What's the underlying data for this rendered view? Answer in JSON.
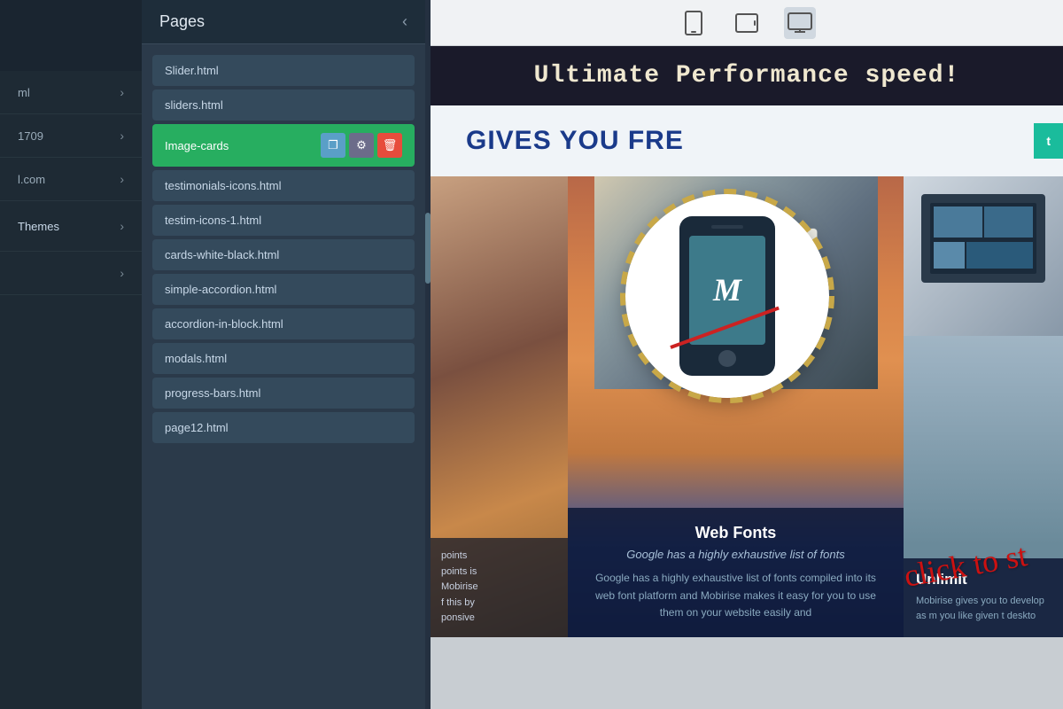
{
  "leftSidebar": {
    "items": [
      {
        "id": "item1",
        "label": "ml",
        "hasArrow": true
      },
      {
        "id": "item2",
        "label": "1709",
        "hasArrow": true
      },
      {
        "id": "item3",
        "label": "l.com",
        "hasArrow": true
      },
      {
        "id": "item4",
        "label": "& Themes",
        "hasArrow": true
      },
      {
        "id": "item5",
        "label": "",
        "hasArrow": true
      }
    ]
  },
  "pagesPanel": {
    "title": "Pages",
    "closeButton": "‹",
    "items": [
      {
        "id": "slider",
        "label": "Slider.html",
        "active": false
      },
      {
        "id": "sliders",
        "label": "sliders.html",
        "active": false
      },
      {
        "id": "image-cards",
        "label": "Image-cards",
        "active": true
      },
      {
        "id": "testimonials-icons",
        "label": "testimonials-icons.html",
        "active": false
      },
      {
        "id": "testim-icons-1",
        "label": "testim-icons-1.html",
        "active": false
      },
      {
        "id": "cards-white-black",
        "label": "cards-white-black.html",
        "active": false
      },
      {
        "id": "simple-accordion",
        "label": "simple-accordion.html",
        "active": false
      },
      {
        "id": "accordion-in-block",
        "label": "accordion-in-block.html",
        "active": false
      },
      {
        "id": "modals",
        "label": "modals.html",
        "active": false
      },
      {
        "id": "progress-bars",
        "label": "progress-bars.html",
        "active": false
      },
      {
        "id": "page12",
        "label": "page12.html",
        "active": false
      }
    ],
    "actions": {
      "copy": "❐",
      "settings": "⚙",
      "delete": "🗑"
    }
  },
  "toolbar": {
    "devices": [
      {
        "id": "mobile",
        "icon": "📱",
        "label": "Mobile view",
        "active": false
      },
      {
        "id": "tablet",
        "icon": "⬜",
        "label": "Tablet view",
        "active": false
      },
      {
        "id": "desktop",
        "icon": "🖥",
        "label": "Desktop view",
        "active": true
      }
    ]
  },
  "preview": {
    "bannerText": "Ultimate Performance speed!",
    "heroTitle": "GIVES YOU FRE",
    "leftCardSubtext": "points",
    "centerCard": {
      "title": "Web Fonts",
      "subtitle": "Google has a highly exhaustive list of fonts",
      "body": "Google has a highly exhaustive list of fonts compiled into its web font platform and Mobirise makes it easy for you to use them on your website easily and"
    },
    "rightCard": {
      "title": "Unlimit",
      "body": "Mobirise gives you to develop as m you like given t deskto"
    },
    "phoneLabel": "M",
    "clickAnnotation": "click to st",
    "tealButton": "t"
  }
}
